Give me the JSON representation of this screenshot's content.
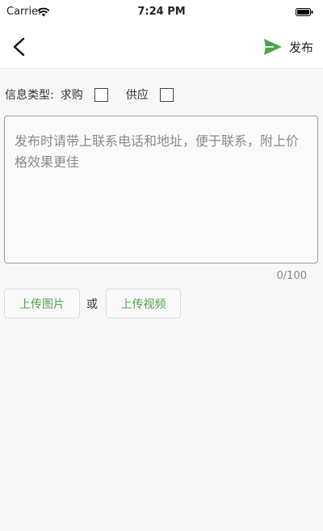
{
  "status_bar": {
    "carrier": "Carrier",
    "time": "7:24 PM"
  },
  "nav": {
    "publish_label": "发布",
    "accent_color": "#4ea24e"
  },
  "info_type": {
    "label": "信息类型:",
    "options": [
      {
        "label": "求购",
        "checked": false
      },
      {
        "label": "供应",
        "checked": false
      }
    ]
  },
  "content": {
    "placeholder": "发布时请带上联系电话和地址，便于联系，附上价格效果更佳",
    "char_count": "0/100"
  },
  "upload": {
    "image_label": "上传图片",
    "or_label": "或",
    "video_label": "上传视频"
  }
}
